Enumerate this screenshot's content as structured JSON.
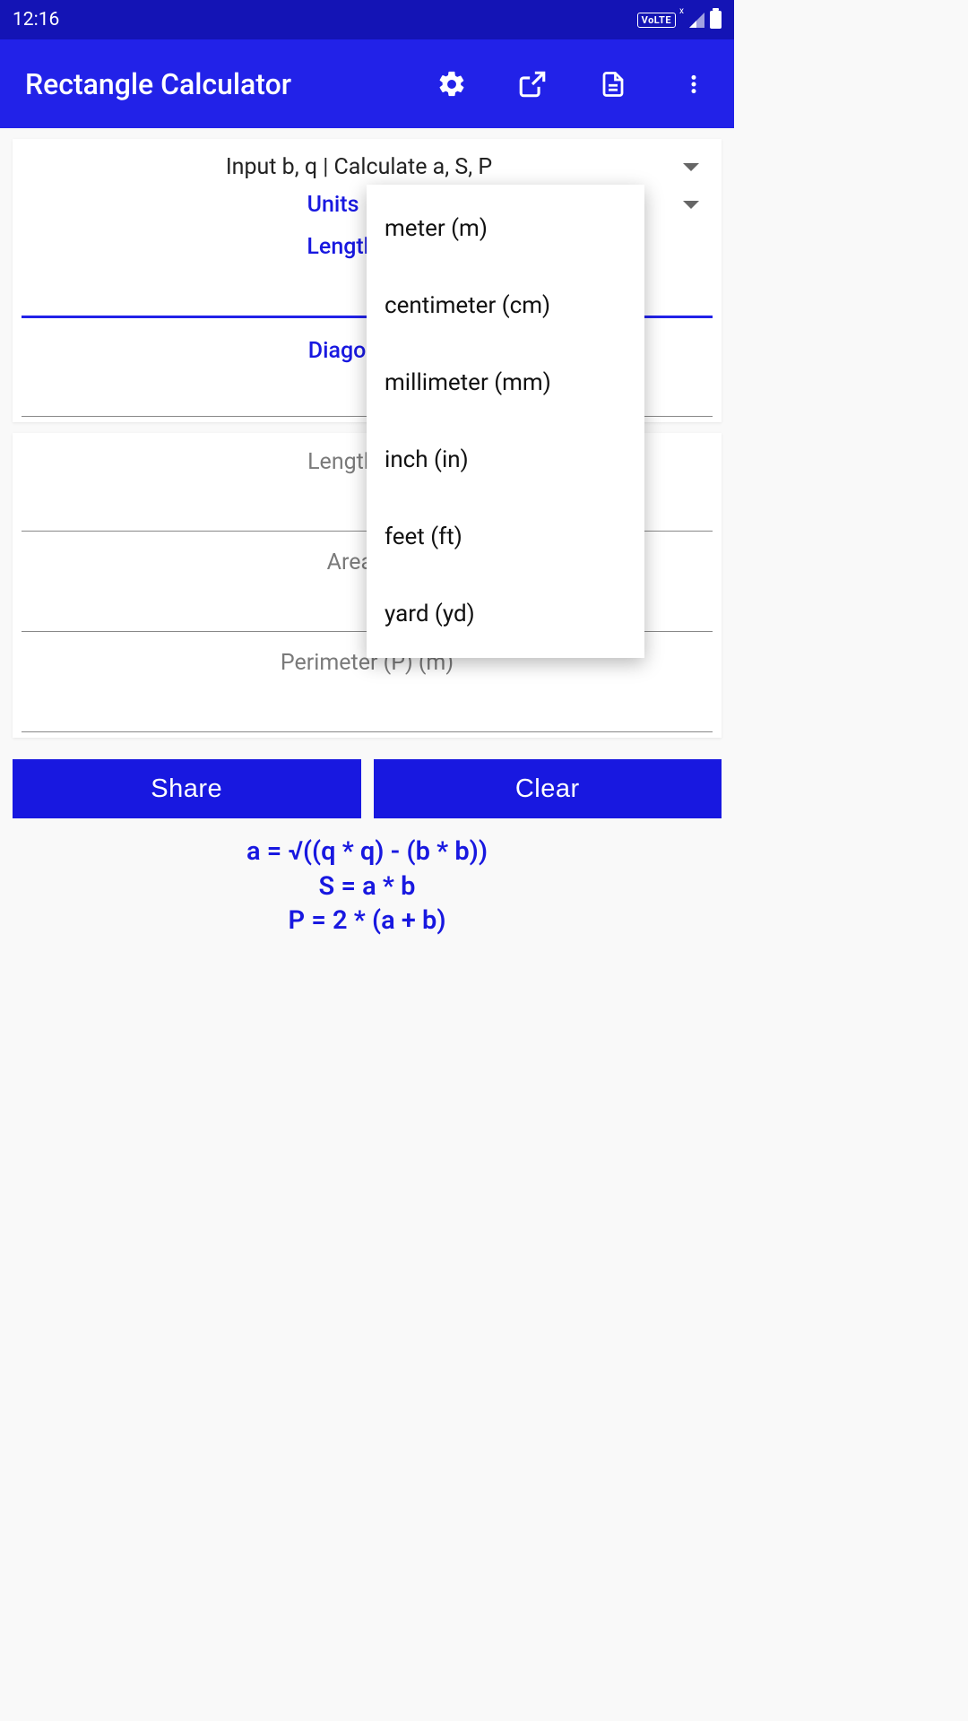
{
  "status": {
    "time": "12:16"
  },
  "appbar": {
    "title": "Rectangle Calculator"
  },
  "card1": {
    "input_mode": "Input b, q | Calculate a, S, P",
    "units_label": "Units",
    "side_b_label": "Length of Si",
    "diagonal_label": "Diagonal Le"
  },
  "card2": {
    "side_a_label": "Length of Si",
    "area_label": "Area (S)",
    "perimeter_label": "Perimeter (P) (m)"
  },
  "buttons": {
    "share": "Share",
    "clear": "Clear"
  },
  "formulas": {
    "line1": "a = √((q * q) - (b * b))",
    "line2": "S = a * b",
    "line3": "P = 2 * (a + b)"
  },
  "units_popup": [
    "meter (m)",
    "centimeter (cm)",
    "millimeter (mm)",
    "inch (in)",
    "feet (ft)",
    "yard (yd)"
  ]
}
